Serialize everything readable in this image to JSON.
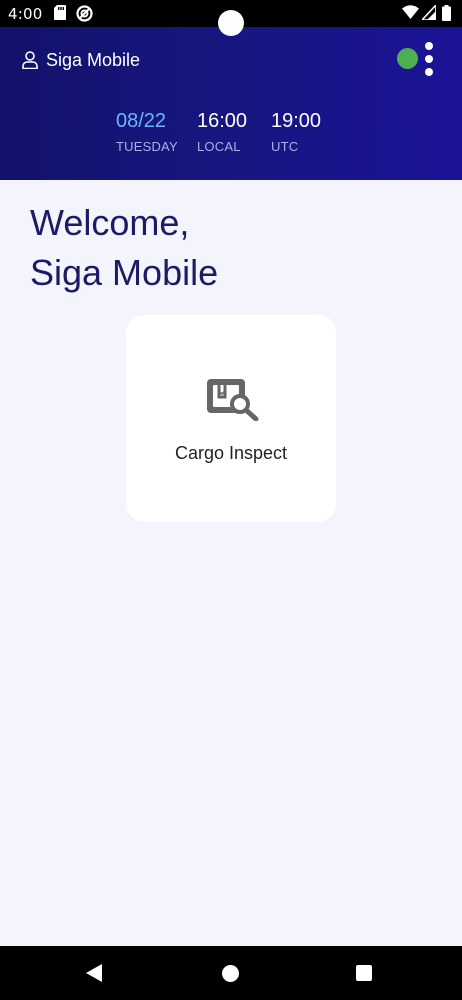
{
  "status_bar": {
    "time": "4:00",
    "left_icons": [
      "sd-card-icon",
      "vpn-icon"
    ],
    "right_icons": [
      "wifi-icon",
      "signal-icon",
      "battery-icon"
    ]
  },
  "header": {
    "user_name": "Siga Mobile",
    "connection_status_color": "#4caf50",
    "date": {
      "value": "08/22",
      "label": "TUESDAY"
    },
    "local_time": {
      "value": "16:00",
      "label": "LOCAL"
    },
    "utc_time": {
      "value": "19:00",
      "label": "UTC"
    }
  },
  "main": {
    "welcome_line1": "Welcome,",
    "welcome_line2": "Siga Mobile",
    "tiles": [
      {
        "label": "Cargo Inspect",
        "icon": "cargo-inspect-icon"
      }
    ]
  },
  "colors": {
    "header_bg": "#17167f",
    "page_bg": "#f4f4fc",
    "date_accent": "#6fb6f6",
    "welcome_text": "#1d1a66"
  },
  "nav_bar": {
    "buttons": [
      "back-icon",
      "home-icon",
      "recents-icon"
    ]
  }
}
